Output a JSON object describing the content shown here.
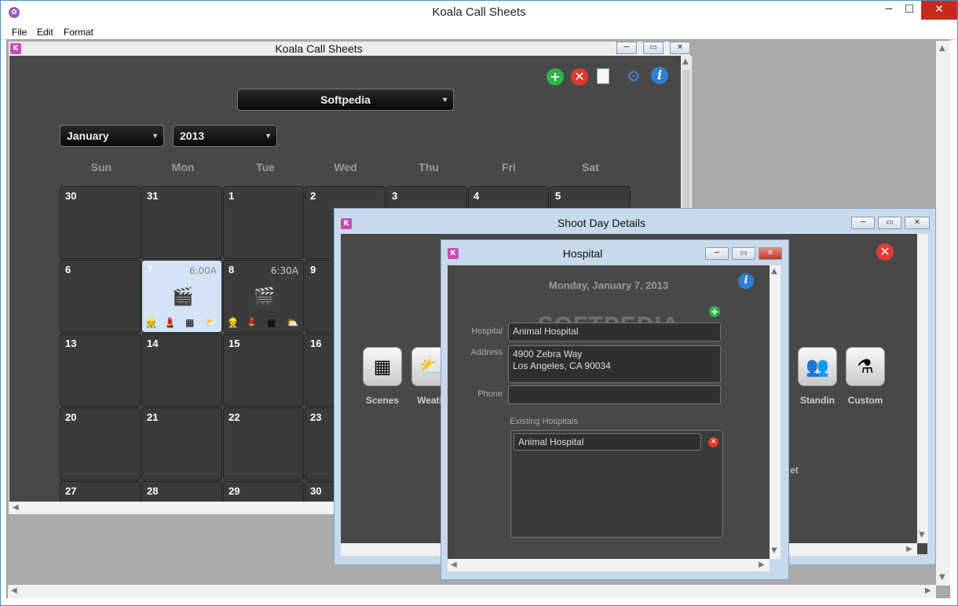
{
  "app": {
    "title": "Koala Call Sheets",
    "menu": [
      "File",
      "Edit",
      "Format"
    ]
  },
  "calendar_window": {
    "title": "Koala Call Sheets",
    "sheet_select": "Softpedia",
    "month_select": "January",
    "year_select": "2013",
    "day_names": [
      "Sun",
      "Mon",
      "Tue",
      "Wed",
      "Thu",
      "Fri",
      "Sat"
    ],
    "rows": [
      [
        "30",
        "31",
        "1",
        "2",
        "3",
        "4",
        "5"
      ],
      [
        "6",
        "7",
        "8",
        "9"
      ],
      [
        "13",
        "14",
        "15",
        "16"
      ],
      [
        "20",
        "21",
        "22",
        "23"
      ],
      [
        "27",
        "28",
        "29",
        "30"
      ]
    ],
    "events": {
      "day7_time": "6:00A",
      "day8_time": "6:30A"
    }
  },
  "shoot_window": {
    "title": "Shoot Day Details",
    "tiles": [
      "Scenes",
      "Weath",
      "Standin",
      "Custom"
    ],
    "partial_text": "et"
  },
  "hospital_window": {
    "title": "Hospital",
    "date_heading": "Monday, January 7, 2013",
    "labels": {
      "hospital": "Hospital",
      "address": "Address",
      "phone": "Phone",
      "existing": "Existing Hospitals"
    },
    "values": {
      "hospital": "Animal Hospital",
      "address_line1": "4900 Zebra Way",
      "address_line2": "Los Angeles, CA 90034",
      "phone": ""
    },
    "existing_hospitals": [
      "Animal Hospital"
    ]
  },
  "watermark": "SOFTPEDIA"
}
